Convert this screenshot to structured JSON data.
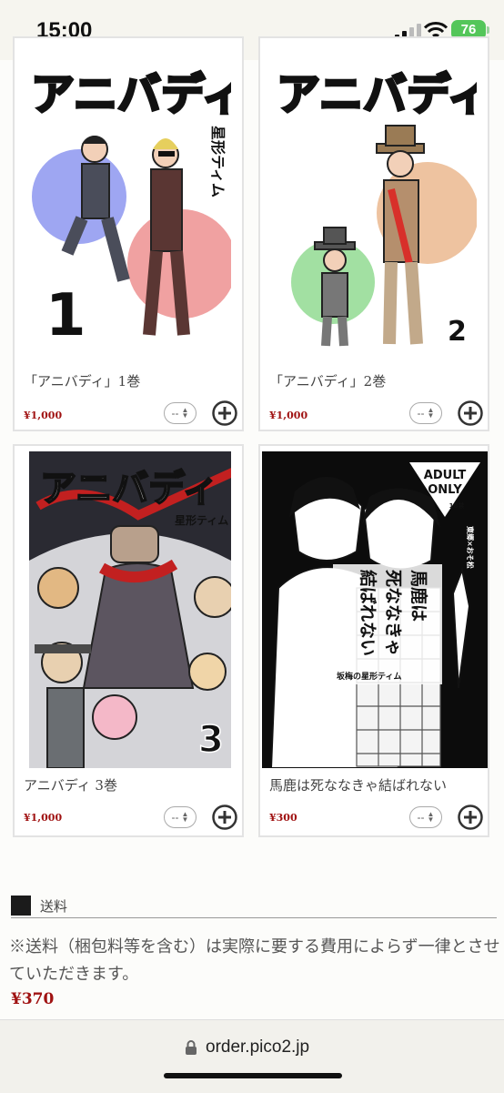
{
  "status_bar": {
    "time": "15:00",
    "battery": "76"
  },
  "products": [
    {
      "title": "「アニバディ」1巻",
      "price": "¥1,000",
      "qty": "--",
      "cover": {
        "logo": "アニバディ",
        "author": "星形ティム",
        "volume": "1"
      }
    },
    {
      "title": "「アニバディ」2巻",
      "price": "¥1,000",
      "qty": "--",
      "cover": {
        "logo": "アニバディ",
        "volume": "2"
      }
    },
    {
      "title": "アニバディ 3巻",
      "price": "¥1,000",
      "qty": "--",
      "cover": {
        "logo": "アニバディ",
        "author": "星形ティム",
        "volume": "3"
      }
    },
    {
      "title": "馬鹿は死ななきゃ結ばれない",
      "price": "¥300",
      "qty": "--",
      "cover": {
        "badge_line1": "ADULT",
        "badge_line2": "ONLY",
        "badge_age": "18禁",
        "pair": "東郷×おそ松",
        "title_col1": "馬鹿は",
        "title_col2": "死ななきゃ",
        "title_col3": "結ばれない",
        "circle": "坂梅の星形ティム"
      }
    }
  ],
  "shipping": {
    "heading": "送料",
    "note": "※送料（梱包料等を含む）は実際に要する費用によらず一律とさせていただきます。",
    "price": "¥370"
  },
  "browser": {
    "url": "order.pico2.jp"
  }
}
